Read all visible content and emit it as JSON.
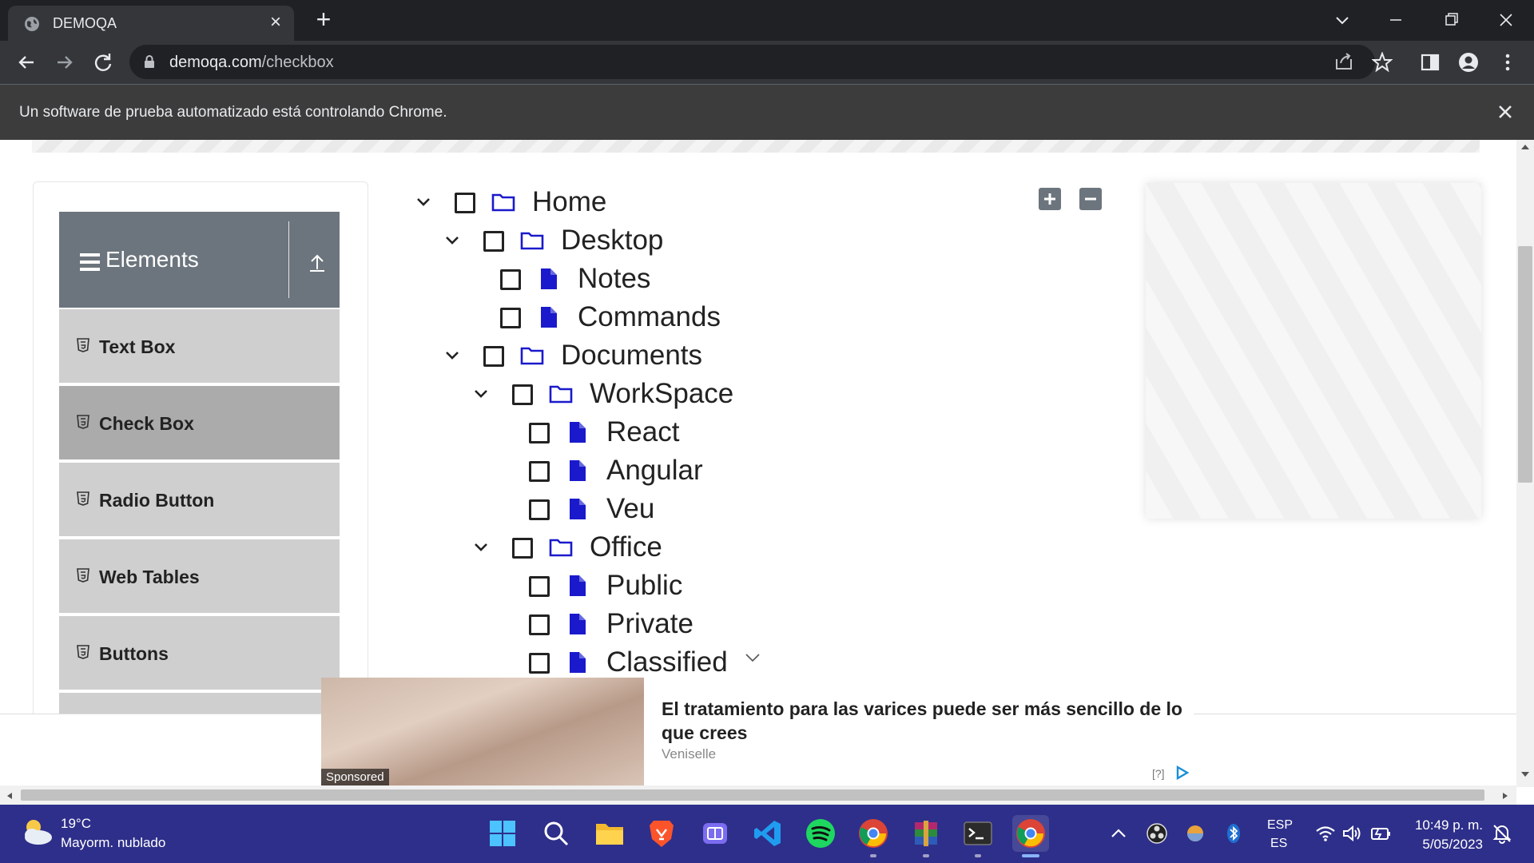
{
  "browser": {
    "tab_title": "DEMOQA",
    "url_host": "demoqa.com",
    "url_path": "/checkbox",
    "infobar_text": "Un software de prueba automatizado está controlando Chrome."
  },
  "sidebar": {
    "group_title": "Elements",
    "items": [
      {
        "label": "Text Box",
        "active": false
      },
      {
        "label": "Check Box",
        "active": true
      },
      {
        "label": "Radio Button",
        "active": false
      },
      {
        "label": "Web Tables",
        "active": false
      },
      {
        "label": "Buttons",
        "active": false
      }
    ]
  },
  "tree": {
    "nodes": [
      {
        "label": "Home",
        "type": "folder",
        "expanded": true
      },
      {
        "label": "Desktop",
        "type": "folder",
        "expanded": true
      },
      {
        "label": "Notes",
        "type": "file"
      },
      {
        "label": "Commands",
        "type": "file"
      },
      {
        "label": "Documents",
        "type": "folder",
        "expanded": true
      },
      {
        "label": "WorkSpace",
        "type": "folder",
        "expanded": true
      },
      {
        "label": "React",
        "type": "file"
      },
      {
        "label": "Angular",
        "type": "file"
      },
      {
        "label": "Veu",
        "type": "file"
      },
      {
        "label": "Office",
        "type": "folder",
        "expanded": true
      },
      {
        "label": "Public",
        "type": "file"
      },
      {
        "label": "Private",
        "type": "file"
      },
      {
        "label": "Classified",
        "type": "file"
      }
    ]
  },
  "ad": {
    "sponsored_label": "Sponsored",
    "title": "El tratamiento para las varices puede ser más sencillo de lo que crees",
    "source": "Veniselle",
    "help": "[?]"
  },
  "taskbar": {
    "temperature": "19°C",
    "weather": "Mayorm. nublado",
    "lang_line1": "ESP",
    "lang_line2": "ES",
    "time": "10:49 p. m.",
    "date": "5/05/2023"
  },
  "colors": {
    "accent_blue": "#1a1acc",
    "sidebar_header": "#6c757d",
    "taskbar": "#2e2f8a"
  }
}
